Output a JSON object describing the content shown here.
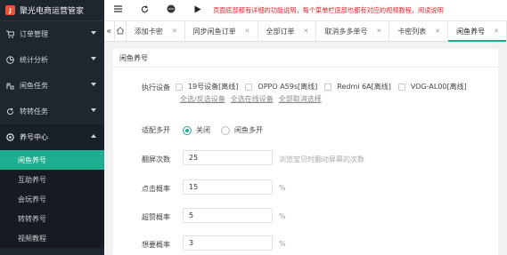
{
  "app": {
    "title": "聚光电商运营管家",
    "logo_glyph": "J"
  },
  "sidebar": {
    "groups": [
      {
        "label": "订单管理",
        "icon": "cart-icon"
      },
      {
        "label": "统计分析",
        "icon": "chart-icon"
      },
      {
        "label": "闲鱼任务",
        "icon": "fish-icon"
      },
      {
        "label": "转转任务",
        "icon": "refresh-icon"
      },
      {
        "label": "养号中心",
        "icon": "gear-icon"
      }
    ],
    "sub_items": [
      "闲鱼养号",
      "互助养号",
      "会玩养号",
      "转转养号",
      "视频教程"
    ]
  },
  "topbar": {
    "notice": "页面底部都有详细的功能说明，每个菜单栏底部也都有对应的视频教程，阅读说明"
  },
  "tabs": [
    {
      "label": "添加卡密"
    },
    {
      "label": "同步闲鱼订单"
    },
    {
      "label": "全部订单"
    },
    {
      "label": "取消多多单号"
    },
    {
      "label": "卡密列表"
    },
    {
      "label": "闲鱼养号"
    }
  ],
  "form": {
    "title": "闲鱼养号",
    "device_label": "执行设备",
    "devices": [
      "19号设备[离线]",
      "OPPO A59s[离线]",
      "Redmi 6A[离线]",
      "VOG-AL00[离线]"
    ],
    "device_links": [
      "全选/反选设备",
      "全选在线设备",
      "全部取消选择"
    ],
    "multi_label": "适配多开",
    "multi_options": [
      "关闭",
      "闲鱼多开"
    ],
    "multi_selected": "关闭",
    "scroll_label": "翻屏次数",
    "scroll_value": "25",
    "scroll_hint": "浏览宝贝时翻动屏幕的次数",
    "click_label": "点击概率",
    "click_value": "15",
    "like_label": "超赞概率",
    "like_value": "5",
    "want_label": "想要概率",
    "want_value": "3",
    "percent": "%"
  },
  "colors": {
    "accent": "#1cae8e",
    "sidebar_bg": "#1f262e",
    "notice": "#e0262a"
  }
}
